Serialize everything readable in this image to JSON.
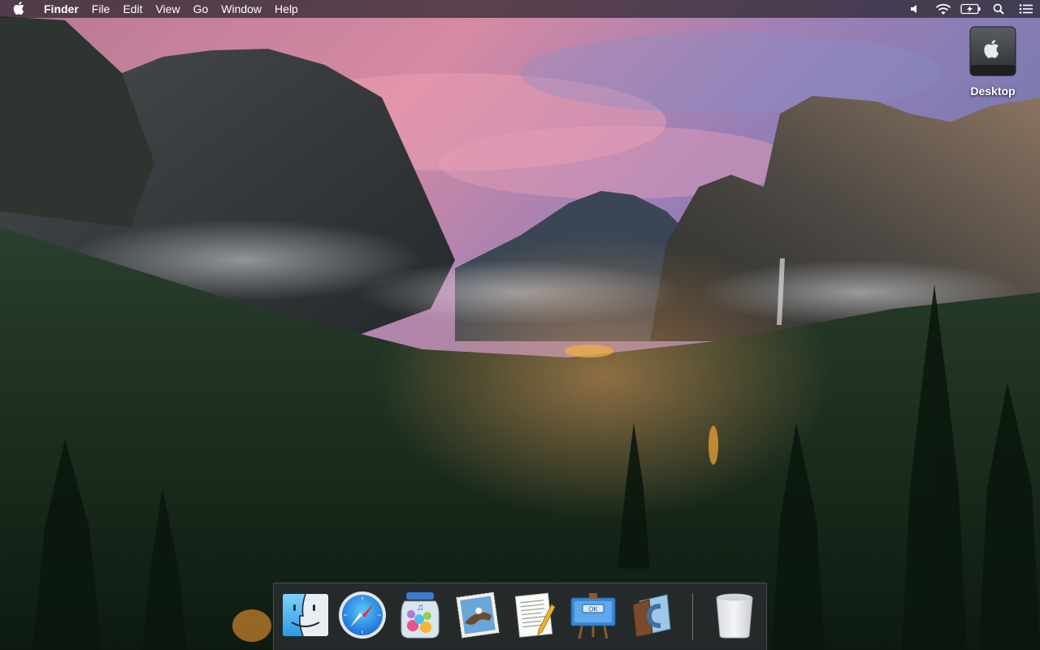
{
  "menubar": {
    "apple_icon": "apple-logo-icon",
    "app_name": "Finder",
    "menus": [
      "File",
      "Edit",
      "View",
      "Go",
      "Window",
      "Help"
    ],
    "status_icons": [
      "volume-icon",
      "wifi-icon",
      "battery-charging-icon",
      "spotlight-search-icon",
      "notification-center-icon"
    ]
  },
  "desktop": {
    "drive_label": "Desktop",
    "drive_icon": "hard-drive-icon"
  },
  "dock": {
    "apps": [
      {
        "icon": "finder-icon",
        "running": true
      },
      {
        "icon": "safari-icon",
        "running": true
      },
      {
        "icon": "itunes-jar-icon",
        "running": false
      },
      {
        "icon": "mail-stamp-icon",
        "running": false
      },
      {
        "icon": "textedit-icon",
        "running": false
      },
      {
        "icon": "xcode-interface-builder-icon",
        "running": false,
        "text": "OK"
      },
      {
        "icon": "calibre-icon",
        "running": false
      },
      {
        "icon": "trash-icon",
        "running": false
      }
    ]
  },
  "colors": {
    "menubar_bg": "#28242c",
    "sky_pink": "#d98aa6",
    "sky_blue": "#6a7fb8",
    "forest": "#1c3322"
  }
}
